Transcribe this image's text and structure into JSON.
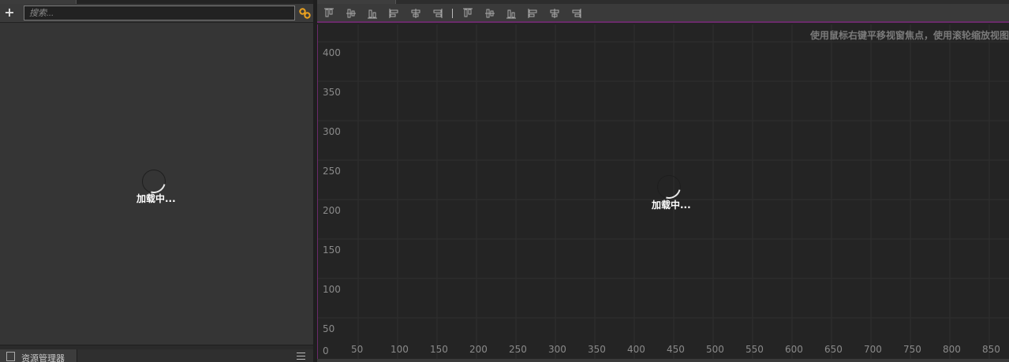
{
  "hierarchy": {
    "add_label": "+",
    "search_placeholder": "搜索...",
    "loading_text": "加载中..."
  },
  "assets": {
    "tab_label": "资源管理器"
  },
  "scene": {
    "hint": "使用鼠标右键平移视窗焦点，使用滚轮缩放视图",
    "loading_text": "加载中...",
    "y_ticks": [
      "400",
      "350",
      "300",
      "250",
      "200",
      "150",
      "100",
      "50"
    ],
    "x_ticks": [
      "50",
      "100",
      "150",
      "200",
      "250",
      "300",
      "350",
      "400",
      "450",
      "500",
      "550",
      "600",
      "650",
      "700",
      "750",
      "800",
      "850"
    ],
    "origin": "0"
  },
  "toolbar": {
    "align_icons": [
      "align-top-icon",
      "align-vcenter-icon",
      "align-bottom-icon",
      "align-left-icon",
      "align-hcenter-icon",
      "align-right-icon",
      "distribute-top-icon",
      "distribute-vcenter-icon",
      "distribute-bottom-icon",
      "distribute-left-icon",
      "distribute-hcenter-icon",
      "distribute-right-icon"
    ]
  },
  "colors": {
    "accent_link": "#e8a020",
    "scene_border": "#6a2a6a"
  }
}
